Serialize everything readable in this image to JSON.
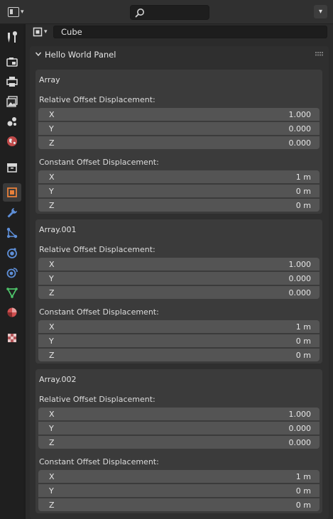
{
  "topbar": {
    "search": {
      "value": ""
    }
  },
  "tabs": [
    {
      "name": "tool-tab",
      "icon": "tool-icon",
      "active": false
    },
    {
      "name": "render-tab",
      "icon": "camera-back-icon",
      "active": false
    },
    {
      "name": "output-tab",
      "icon": "printer-icon",
      "active": false
    },
    {
      "name": "view-layer-tab",
      "icon": "image-icon",
      "active": false
    },
    {
      "name": "scene-tab",
      "icon": "scene-icon",
      "active": false
    },
    {
      "name": "world-tab",
      "icon": "world-icon",
      "active": false
    },
    {
      "name": "collection-tab",
      "icon": "collection-box-icon",
      "active": false
    },
    {
      "name": "object-tab",
      "icon": "object-cube-icon",
      "active": true
    },
    {
      "name": "modifier-tab",
      "icon": "wrench-icon",
      "active": false
    },
    {
      "name": "particles-tab",
      "icon": "particles-icon",
      "active": false
    },
    {
      "name": "physics-tab",
      "icon": "physics-icon",
      "active": false
    },
    {
      "name": "constraints-tab",
      "icon": "constraint-icon",
      "active": false
    },
    {
      "name": "data-tab",
      "icon": "mesh-triangle-icon",
      "active": false
    },
    {
      "name": "material-tab",
      "icon": "material-sphere-icon",
      "active": false
    },
    {
      "name": "texture-tab",
      "icon": "texture-checker-icon",
      "active": false
    }
  ],
  "object": {
    "name": "Cube"
  },
  "panel": {
    "title": "Hello World Panel",
    "modifiers": [
      {
        "name": "Array",
        "relative_label": "Relative Offset Displacement:",
        "relative": [
          {
            "axis": "X",
            "value": "1.000"
          },
          {
            "axis": "Y",
            "value": "0.000"
          },
          {
            "axis": "Z",
            "value": "0.000"
          }
        ],
        "constant_label": "Constant Offset Displacement:",
        "constant": [
          {
            "axis": "X",
            "value": "1 m"
          },
          {
            "axis": "Y",
            "value": "0 m"
          },
          {
            "axis": "Z",
            "value": "0 m"
          }
        ]
      },
      {
        "name": "Array.001",
        "relative_label": "Relative Offset Displacement:",
        "relative": [
          {
            "axis": "X",
            "value": "1.000"
          },
          {
            "axis": "Y",
            "value": "0.000"
          },
          {
            "axis": "Z",
            "value": "0.000"
          }
        ],
        "constant_label": "Constant Offset Displacement:",
        "constant": [
          {
            "axis": "X",
            "value": "1 m"
          },
          {
            "axis": "Y",
            "value": "0 m"
          },
          {
            "axis": "Z",
            "value": "0 m"
          }
        ]
      },
      {
        "name": "Array.002",
        "relative_label": "Relative Offset Displacement:",
        "relative": [
          {
            "axis": "X",
            "value": "1.000"
          },
          {
            "axis": "Y",
            "value": "0.000"
          },
          {
            "axis": "Z",
            "value": "0.000"
          }
        ],
        "constant_label": "Constant Offset Displacement:",
        "constant": [
          {
            "axis": "X",
            "value": "1 m"
          },
          {
            "axis": "Y",
            "value": "0 m"
          },
          {
            "axis": "Z",
            "value": "0 m"
          }
        ]
      }
    ]
  },
  "colors": {
    "accent_orange": "#e8803a",
    "modifier_blue": "#5e8fd8",
    "data_green": "#4ec36a",
    "world_red": "#c04a4a"
  }
}
